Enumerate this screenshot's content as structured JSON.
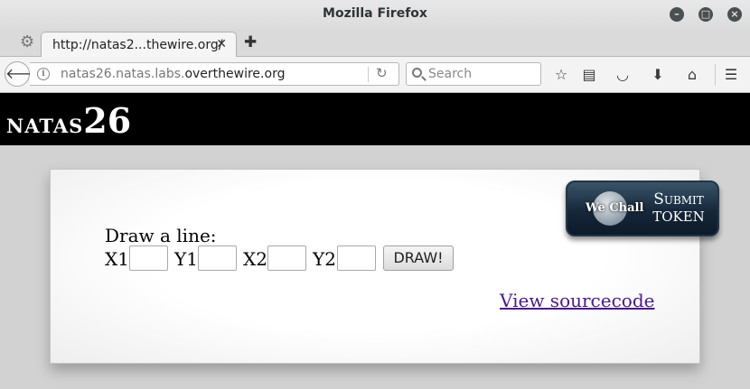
{
  "window": {
    "title": "Mozilla Firefox"
  },
  "tabs": [
    {
      "title": "http://natas2...thewire.org/"
    }
  ],
  "nav": {
    "url_prefix": "natas26.natas.labs.",
    "url_domain": "overthewire.org",
    "search_placeholder": "Search"
  },
  "icons": {
    "settings": "gear-icon",
    "back": "back-arrow-icon",
    "info": "info-icon",
    "reload": "reload-icon",
    "search": "search-icon",
    "bookmark": "star-icon",
    "reading_list": "reading-list-icon",
    "pocket": "pocket-icon",
    "download": "download-icon",
    "home": "home-icon",
    "menu": "hamburger-menu-icon"
  },
  "page": {
    "logo_word": "natas",
    "logo_number": "26",
    "draw_label": "Draw a line:",
    "fields": [
      {
        "label": "X1",
        "value": ""
      },
      {
        "label": "Y1",
        "value": ""
      },
      {
        "label": "X2",
        "value": ""
      },
      {
        "label": "Y2",
        "value": ""
      }
    ],
    "draw_button": "DRAW!",
    "source_link": "View sourcecode",
    "wechall": {
      "brand": "We Chall",
      "submit": "Submit",
      "token": "TOKEN"
    }
  },
  "colors": {
    "header_bg": "#000000",
    "link": "#4b1a86",
    "page_bg": "#d2d2d2"
  }
}
